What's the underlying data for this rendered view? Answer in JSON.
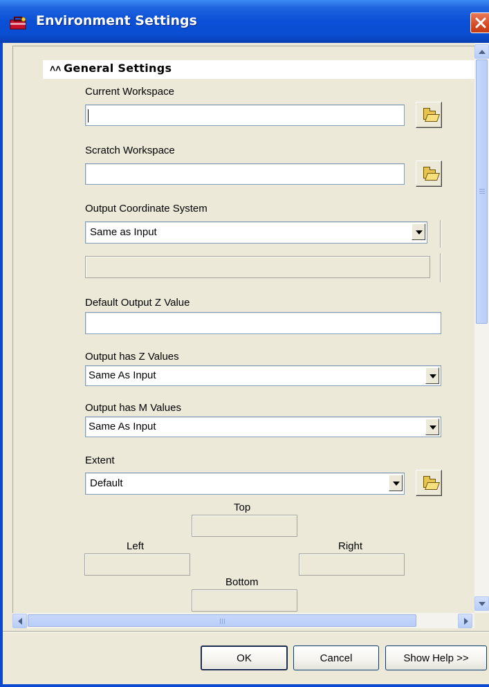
{
  "window": {
    "title": "Environment Settings",
    "icon": "toolbox-icon",
    "close_icon": "close-icon"
  },
  "section": {
    "chevron": "˄˄",
    "title": "General Settings"
  },
  "fields": {
    "current_workspace": {
      "label": "Current Workspace",
      "value": ""
    },
    "scratch_workspace": {
      "label": "Scratch Workspace",
      "value": ""
    },
    "output_coordinate_system": {
      "label": "Output Coordinate System",
      "selected": "Same as Input",
      "detail": ""
    },
    "default_output_z": {
      "label": "Default Output Z Value",
      "value": ""
    },
    "output_has_z": {
      "label": "Output has Z Values",
      "selected": "Same As Input"
    },
    "output_has_m": {
      "label": "Output has M Values",
      "selected": "Same As Input"
    },
    "extent": {
      "label": "Extent",
      "selected": "Default",
      "top_label": "Top",
      "left_label": "Left",
      "right_label": "Right",
      "bottom_label": "Bottom"
    }
  },
  "buttons": {
    "ok": "OK",
    "cancel": "Cancel",
    "show_help": "Show Help >>"
  },
  "colors": {
    "titlebar": "#0a4fd6",
    "dialog_bg": "#ece9d8",
    "scroll_thumb": "#b8cdf8"
  }
}
